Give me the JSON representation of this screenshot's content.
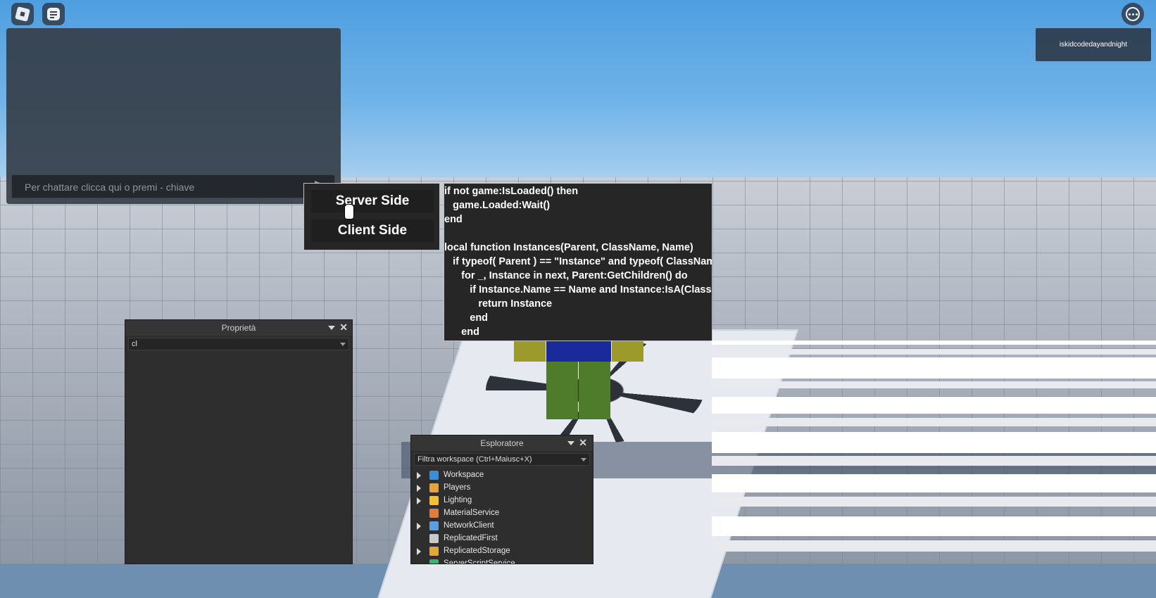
{
  "chat": {
    "placeholder": "Per chattare clicca qui o premi - chiave"
  },
  "player_list": {
    "players": [
      "iskidcodedayandnight"
    ]
  },
  "executor": {
    "server_side_label": "Server Side",
    "client_side_label": "Client Side",
    "code_lines": [
      "if not game:IsLoaded() then",
      "   game.Loaded:Wait()",
      "end",
      "",
      "local function Instances(Parent, ClassName, Name)",
      "   if typeof( Parent ) == \"Instance\" and typeof( ClassName",
      "      for _, Instance in next, Parent:GetChildren() do",
      "         if Instance.Name == Name and Instance:IsA(ClassName",
      "            return Instance",
      "         end",
      "      end"
    ]
  },
  "properties": {
    "title": "Proprietà",
    "filter_value": "cl"
  },
  "explorer": {
    "title": "Esploratore",
    "filter_placeholder": "Filtra workspace (Ctrl+Maiusc+X)",
    "items": [
      {
        "label": "Workspace",
        "expandable": true,
        "icon": "globe-icon",
        "color": "#3b8fd9"
      },
      {
        "label": "Players",
        "expandable": true,
        "icon": "players-icon",
        "color": "#e6a23c"
      },
      {
        "label": "Lighting",
        "expandable": true,
        "icon": "lightbulb-icon",
        "color": "#f1c232"
      },
      {
        "label": "MaterialService",
        "expandable": false,
        "icon": "material-icon",
        "color": "#e07b39"
      },
      {
        "label": "NetworkClient",
        "expandable": true,
        "icon": "network-icon",
        "color": "#5aa0e0"
      },
      {
        "label": "ReplicatedFirst",
        "expandable": false,
        "icon": "replicated-first-icon",
        "color": "#c9c9c9"
      },
      {
        "label": "ReplicatedStorage",
        "expandable": true,
        "icon": "storage-icon",
        "color": "#e0a840"
      },
      {
        "label": "ServerScriptService",
        "expandable": false,
        "icon": "script-service-icon",
        "color": "#3cb371"
      }
    ]
  },
  "colors": {
    "panel_bg": "#262626",
    "studio_panel_bg": "#2e2e2e",
    "sky_top": "#4f9ee0",
    "noob_torso": "#1b2a9a",
    "noob_arms": "#9b9a2a",
    "noob_legs": "#4f7c2a"
  }
}
